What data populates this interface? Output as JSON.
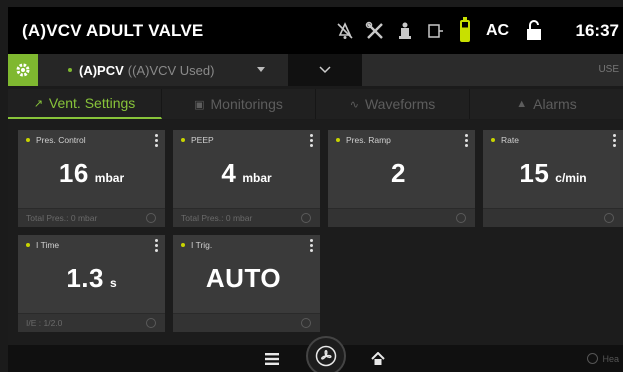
{
  "header": {
    "title": "(A)VCV ADULT VALVE",
    "icons": [
      "alarm-off-icon",
      "tools-icon",
      "patient-icon",
      "bed-icon",
      "battery-icon",
      "unlock-icon"
    ],
    "power_label": "AC",
    "time": "16:37"
  },
  "mode_bar": {
    "settings_icon": "gear-icon",
    "mode": "(A)PCV",
    "used_mode": "((A)VCV Used)",
    "user_text": "USE"
  },
  "tabs": [
    {
      "label": "Vent. Settings",
      "icon": "ventilation-icon",
      "active": true
    },
    {
      "label": "Monitorings",
      "icon": "monitor-icon",
      "active": false
    },
    {
      "label": "Waveforms",
      "icon": "waveform-icon",
      "active": false
    },
    {
      "label": "Alarms",
      "icon": "bell-icon",
      "active": false
    }
  ],
  "tiles": [
    {
      "name": "Pres. Control",
      "value": "16",
      "unit": "mbar",
      "footer": "Total Pres.: 0 mbar"
    },
    {
      "name": "PEEP",
      "value": "4",
      "unit": "mbar",
      "footer": "Total Pres.: 0 mbar"
    },
    {
      "name": "Pres. Ramp",
      "value": "2",
      "unit": "",
      "footer": ""
    },
    {
      "name": "Rate",
      "value": "15",
      "unit": "c/min",
      "footer": ""
    },
    {
      "name": "I Time",
      "value": "1.3",
      "unit": "s",
      "footer": "I/E : 1/2.0"
    },
    {
      "name": "I Trig.",
      "value": "AUTO",
      "unit": "",
      "footer": ""
    }
  ],
  "bottom_bar": {
    "menu_icon": "menu-icon",
    "fan_icon": "fan-icon",
    "home_icon": "home-icon",
    "pause_text": "Hea"
  },
  "colors": {
    "accent_green": "#88c43a",
    "tile_bg": "#3a3a3a",
    "indicator_yellow": "#c8d400"
  }
}
